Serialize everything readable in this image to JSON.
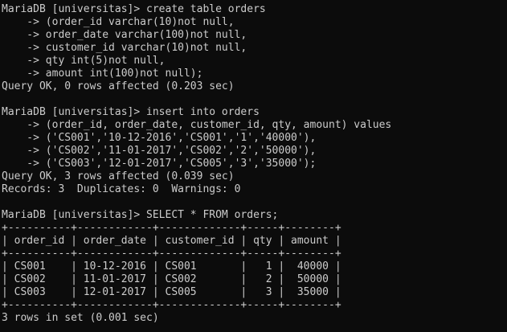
{
  "terminal": {
    "lines": [
      "MariaDB [universitas]> create table orders",
      "    -> (order_id varchar(10)not null,",
      "    -> order_date varchar(100)not null,",
      "    -> customer_id varchar(10)not null,",
      "    -> qty int(5)not null,",
      "    -> amount int(100)not null);",
      "Query OK, 0 rows affected (0.203 sec)",
      "",
      "MariaDB [universitas]> insert into orders",
      "    -> (order_id, order_date, customer_id, qty, amount) values",
      "    -> ('CS001','10-12-2016','CS001','1','40000'),",
      "    -> ('CS002','11-01-2017','CS002','2','50000'),",
      "    -> ('CS003','12-01-2017','CS005','3','35000');",
      "Query OK, 3 rows affected (0.039 sec)",
      "Records: 3  Duplicates: 0  Warnings: 0",
      "",
      "MariaDB [universitas]> SELECT * FROM orders;",
      "+----------+------------+-------------+-----+--------+",
      "| order_id | order_date | customer_id | qty | amount |",
      "+----------+------------+-------------+-----+--------+",
      "| CS001    | 10-12-2016 | CS001       |   1 |  40000 |",
      "| CS002    | 11-01-2017 | CS002       |   2 |  50000 |",
      "| CS003    | 12-01-2017 | CS005       |   3 |  35000 |",
      "+----------+------------+-------------+-----+--------+",
      "3 rows in set (0.001 sec)"
    ]
  }
}
